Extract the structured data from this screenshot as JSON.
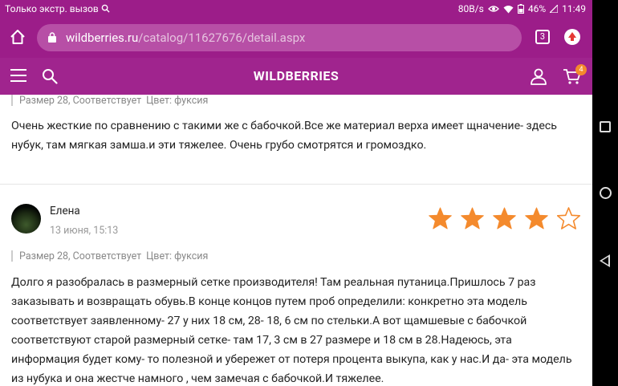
{
  "status_bar": {
    "carrier_text": "Только экстр. вызов",
    "speed": "80B/s",
    "battery": "46%",
    "time": "11:49"
  },
  "browser": {
    "url_host": "wildberries.ru",
    "url_path": "/catalog/11627676/detail.aspx",
    "tab_count": "3"
  },
  "site_header": {
    "logo": "WILDBERRIES",
    "cart_count": "4"
  },
  "reviews": [
    {
      "meta_size": "Размер 28, Соответствует",
      "meta_color": "Цвет: фуксия",
      "text": "Очень жесткие по сравнению с такими же с бабочкой.Все же материал верха имеет щначение- здесь нубук, там мягкая замша.и эти тяжелее. Очень грубо смотрятся и громоздко."
    },
    {
      "author": "Елена",
      "date": "13 июня, 15:13",
      "rating": 4,
      "max_rating": 5,
      "meta_size": "Размер 28, Соответствует",
      "meta_color": "Цвет: фуксия",
      "text": "Долго я разобралась в размерный сетке производителя! Там реальная путаница.Пришлось 7 раз заказывать и возвращать обувь.В конце концов путем проб определили: конкретно эта модель соответствует заявленному- 27 у них 18 см, 28- 18, 6 см по стельки.А вот щамшевые с бабочкой соответствуют старой размерный сетке- там 17, 3 см в 27 размере и 18 см в 28.Надеюсь, эта информация будет кому- то полезной и убережет от потеря процента выкупа, как у нас.И да- эта модель из нубука и она жестче намного , чем замечая с бабочкой.И тяжелее."
    }
  ],
  "colors": {
    "brand": "#a0248e",
    "star": "#f48a2d"
  }
}
